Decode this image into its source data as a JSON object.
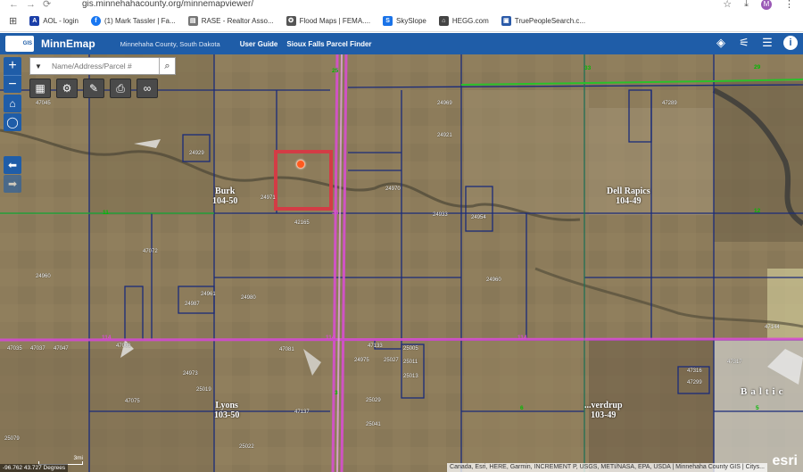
{
  "browser": {
    "url": "gis.minnehahacounty.org/minnemapviewer/",
    "profile_initial": "M",
    "bookmarks": [
      {
        "label": "AOL - login",
        "color": "#1b3fa8",
        "glyph": "A"
      },
      {
        "label": "(1) Mark Tassler | Fa...",
        "color": "#1877f2",
        "glyph": "f"
      },
      {
        "label": "RASE - Realtor Asso...",
        "color": "#666666",
        "glyph": "▤"
      },
      {
        "label": "Flood Maps | FEMA....",
        "color": "#555555",
        "glyph": "✪"
      },
      {
        "label": "SkySlope",
        "color": "#1a73e8",
        "glyph": "S"
      },
      {
        "label": "HEGG.com",
        "color": "#444444",
        "glyph": "⌂"
      },
      {
        "label": "TruePeopleSearch.c...",
        "color": "#2a5aa8",
        "glyph": "▣"
      }
    ]
  },
  "header": {
    "logo_text": "GIS",
    "title": "MinnEmap",
    "county": "Minnehaha County, South Dakota",
    "links": [
      "User Guide",
      "Sioux Falls Parcel Finder"
    ],
    "icons": [
      "layers-icon",
      "measure-icon",
      "list-icon",
      "info-icon"
    ]
  },
  "map": {
    "search_placeholder": "Name/Address/Parcel #",
    "townships": [
      {
        "name": "Burk",
        "number": "104-50"
      },
      {
        "name": "Dell Rapics",
        "number": "104-49"
      },
      {
        "name": "Lyons",
        "number": "103-50"
      },
      {
        "name": "...verdrup",
        "number": "103-49"
      },
      {
        "name": "Baltic",
        "number": ""
      }
    ],
    "parcel_labels": [
      "47045",
      "24929",
      "24969",
      "24921",
      "24971",
      "47289",
      "24970",
      "24933",
      "42165",
      "24954",
      "47072",
      "24960",
      "24961",
      "24987",
      "24960",
      "47035",
      "47037",
      "47047",
      "47063",
      "47133",
      "25005",
      "25011",
      "25013",
      "24975",
      "47075",
      "25019",
      "47137",
      "25029",
      "25041",
      "25022",
      "25079",
      "47317",
      "47299",
      "47316",
      "24973",
      "47144",
      "47081",
      "25027",
      "24980"
    ],
    "highway_labels": [
      "25",
      "33",
      "29",
      "38",
      "11",
      "12",
      "114",
      "114",
      "114",
      "5",
      "3",
      "6"
    ],
    "coordinates": "-96.762 43.727 Degrees",
    "scale": "3mi",
    "attribution": "Canada, Esri, HERE, Garmin, INCREMENT P, USGS, METI/NASA, EPA, USDA | Minnehaha County GIS | Citys...",
    "esri": "esri"
  }
}
